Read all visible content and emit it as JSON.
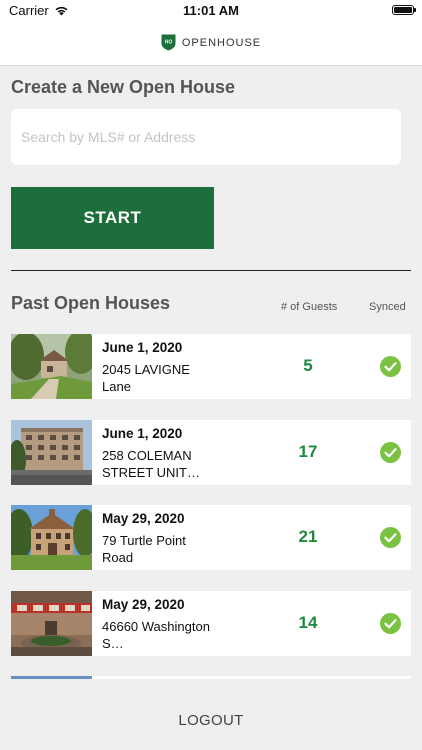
{
  "status_bar": {
    "carrier": "Carrier",
    "time": "11:01 AM"
  },
  "brand": {
    "logo_text": "HO",
    "name": "OPENHOUSE",
    "color": "#1c6e3a"
  },
  "create": {
    "title": "Create a New Open House",
    "search_placeholder": "Search by MLS# or Address",
    "start_label": "START"
  },
  "past": {
    "title": "Past Open Houses",
    "guests_header": "# of Guests",
    "synced_header": "Synced",
    "items": [
      {
        "date": "June 1, 2020",
        "address": "2045 LAVIGNE Lane",
        "guests": "5",
        "synced": true
      },
      {
        "date": "June 1, 2020",
        "address": "258 COLEMAN STREET UNIT…",
        "guests": "17",
        "synced": true
      },
      {
        "date": "May 29, 2020",
        "address": "79 Turtle Point Road",
        "guests": "21",
        "synced": true
      },
      {
        "date": "May 29, 2020",
        "address": "46660 Washington S…",
        "guests": "14",
        "synced": true
      }
    ]
  },
  "footer": {
    "logout_label": "LOGOUT"
  },
  "colors": {
    "accent": "#1c6e3a",
    "guest_count": "#1f8a3e",
    "synced_check": "#7cc242",
    "background": "#efeff0"
  }
}
